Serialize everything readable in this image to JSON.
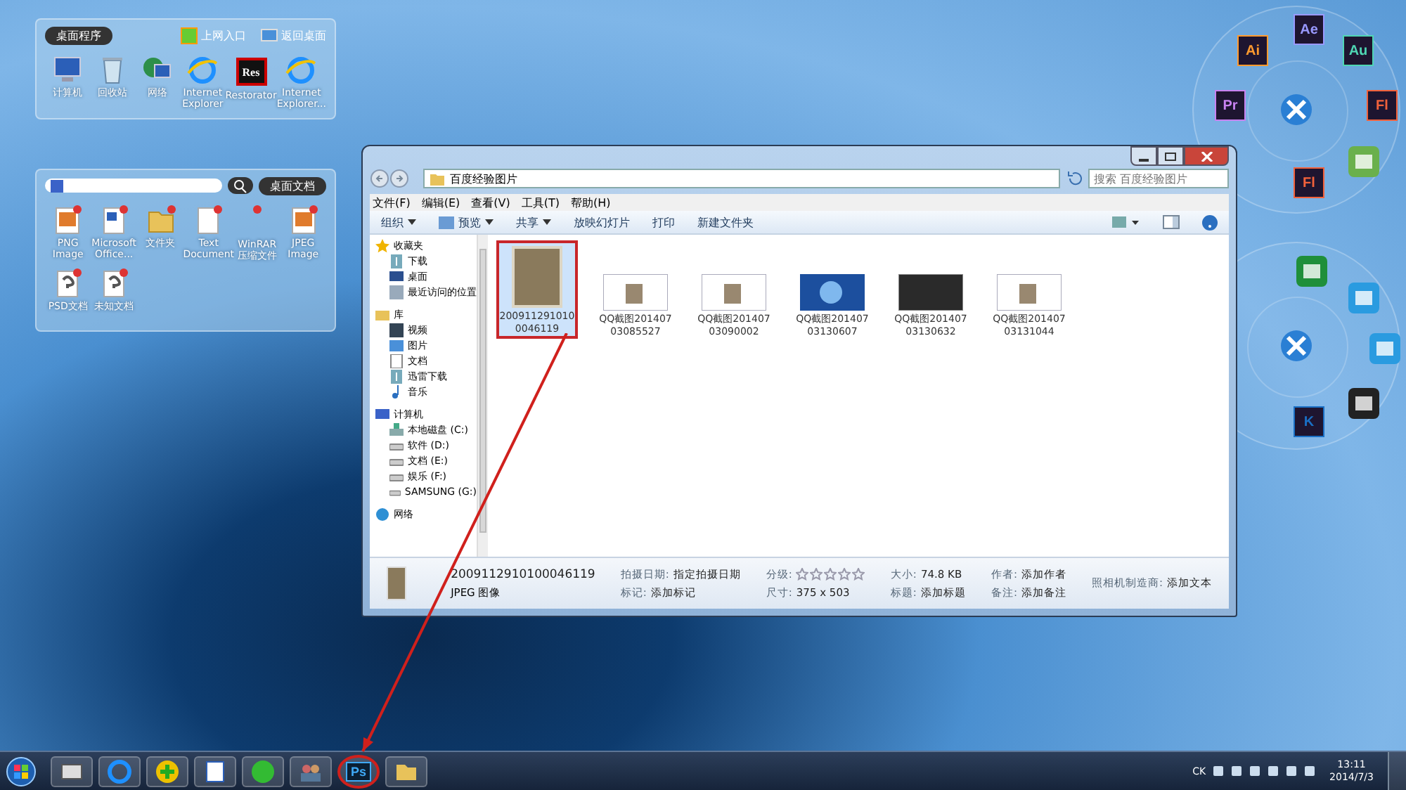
{
  "gadget_programs": {
    "title": "桌面程序",
    "links": [
      {
        "label": "上网入口",
        "kind": "web"
      },
      {
        "label": "返回桌面",
        "kind": "desktop"
      }
    ],
    "items": [
      {
        "label": "计算机",
        "kind": "computer"
      },
      {
        "label": "回收站",
        "kind": "bin"
      },
      {
        "label": "网络",
        "kind": "network"
      },
      {
        "label": "Internet Explorer",
        "kind": "ie"
      },
      {
        "label": "Restorator",
        "kind": "res",
        "badge": "Res"
      },
      {
        "label": "Internet Explorer...",
        "kind": "ie"
      }
    ]
  },
  "gadget_documents": {
    "title": "桌面文档",
    "items": [
      {
        "label": "PNG Image",
        "kind": "image"
      },
      {
        "label": "Microsoft Office...",
        "kind": "office"
      },
      {
        "label": "文件夹",
        "kind": "folder"
      },
      {
        "label": "Text Document",
        "kind": "text"
      },
      {
        "label": "WinRAR 压缩文件",
        "kind": "blank"
      },
      {
        "label": "JPEG Image",
        "kind": "image"
      },
      {
        "label": "PSD文档",
        "kind": "unknown"
      },
      {
        "label": "未知文档",
        "kind": "unknown"
      }
    ]
  },
  "explorer": {
    "breadcrumb": "百度经验图片",
    "search_placeholder": "搜索 百度经验图片",
    "menu": [
      "文件(F)",
      "编辑(E)",
      "查看(V)",
      "工具(T)",
      "帮助(H)"
    ],
    "toolbar": [
      {
        "label": "组织",
        "dropdown": true
      },
      {
        "label": "预览",
        "dropdown": true
      },
      {
        "label": "共享",
        "dropdown": true
      },
      {
        "label": "放映幻灯片",
        "dropdown": false
      },
      {
        "label": "打印",
        "dropdown": false
      },
      {
        "label": "新建文件夹",
        "dropdown": false
      }
    ],
    "nav": [
      {
        "label": "收藏夹",
        "kind": "star",
        "children": [
          {
            "label": "下载",
            "kind": "download"
          },
          {
            "label": "桌面",
            "kind": "desktop"
          },
          {
            "label": "最近访问的位置",
            "kind": "recent"
          }
        ]
      },
      {
        "label": "库",
        "kind": "library",
        "children": [
          {
            "label": "视频",
            "kind": "video"
          },
          {
            "label": "图片",
            "kind": "picture"
          },
          {
            "label": "文档",
            "kind": "doc"
          },
          {
            "label": "迅雷下载",
            "kind": "download"
          },
          {
            "label": "音乐",
            "kind": "music"
          }
        ]
      },
      {
        "label": "计算机",
        "kind": "computer",
        "children": [
          {
            "label": "本地磁盘 (C:)",
            "kind": "disk"
          },
          {
            "label": "软件 (D:)",
            "kind": "drive"
          },
          {
            "label": "文档 (E:)",
            "kind": "drive"
          },
          {
            "label": "娱乐 (F:)",
            "kind": "drive"
          },
          {
            "label": "SAMSUNG (G:)",
            "kind": "drive"
          }
        ]
      },
      {
        "label": "网络",
        "kind": "network"
      }
    ],
    "files": [
      {
        "name": "2009112910100046119",
        "kind": "photo",
        "selected": true,
        "highlighted": true
      },
      {
        "name": "QQ截图20140703085527",
        "kind": "light",
        "selected": false,
        "highlighted": false
      },
      {
        "name": "QQ截图20140703090002",
        "kind": "light",
        "selected": false,
        "highlighted": false
      },
      {
        "name": "QQ截图20140703130607",
        "kind": "blue",
        "selected": false,
        "highlighted": false
      },
      {
        "name": "QQ截图20140703130632",
        "kind": "dark",
        "selected": false,
        "highlighted": false
      },
      {
        "name": "QQ截图20140703131044",
        "kind": "light",
        "selected": false,
        "highlighted": false
      }
    ],
    "details": {
      "name": "2009112910100046119",
      "type": "JPEG 图像",
      "stars": 0,
      "rating_label": "分级:",
      "fields": [
        {
          "label": "拍摄日期:",
          "value": "指定拍摄日期"
        },
        {
          "label": "标记:",
          "value": "添加标记"
        },
        {
          "label": "尺寸:",
          "value": "375 x 503"
        },
        {
          "label": "大小:",
          "value": "74.8 KB"
        },
        {
          "label": "标题:",
          "value": "添加标题"
        },
        {
          "label": "作者:",
          "value": "添加作者"
        },
        {
          "label": "备注:",
          "value": "添加备注"
        },
        {
          "label": "照相机制造商:",
          "value": "添加文本"
        }
      ]
    }
  },
  "launchers": [
    {
      "apps": [
        {
          "label": "Ae",
          "color": "#9999ff"
        },
        {
          "label": "Au",
          "color": "#4fd6b4"
        },
        {
          "label": "Fl",
          "color": "#f2613b"
        },
        {
          "color": "#6ab04c"
        },
        {
          "label": "Fl",
          "color": "#f2613b"
        },
        {
          "label": "Pr",
          "color": "#c882f0"
        },
        {
          "label": "Ai",
          "color": "#ff9a2e"
        }
      ]
    },
    {
      "apps": [
        {
          "color": "#1f8f3a"
        },
        {
          "color": "#2a9be0"
        },
        {
          "color": "#2a9be0"
        },
        {
          "color": "#222222"
        },
        {
          "label": "K",
          "color": "#1a6fc4"
        }
      ]
    }
  ],
  "annotation_arrow": true,
  "taskbar": {
    "apps": [
      {
        "kind": "tool",
        "highlighted": false
      },
      {
        "kind": "ie",
        "highlighted": false
      },
      {
        "kind": "plus",
        "highlighted": false
      },
      {
        "kind": "word",
        "highlighted": false
      },
      {
        "kind": "green",
        "highlighted": false
      },
      {
        "kind": "people",
        "highlighted": false
      },
      {
        "kind": "ps",
        "label": "Ps",
        "highlighted": true
      },
      {
        "kind": "folder",
        "highlighted": false
      }
    ],
    "language": "CK",
    "time": "13:11",
    "date": "2014/7/3"
  }
}
